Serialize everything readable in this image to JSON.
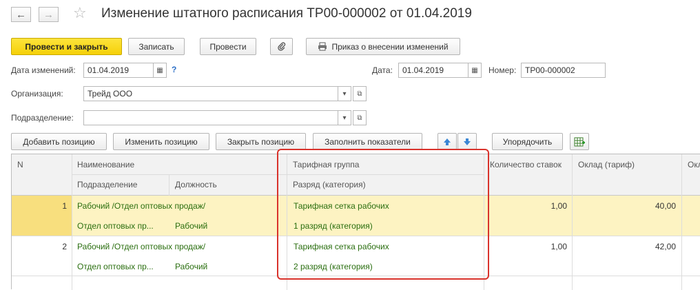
{
  "window": {
    "title": "Изменение штатного расписания ТР00-000002 от 01.04.2019"
  },
  "toolbar": {
    "post_close": "Провести и закрыть",
    "save": "Записать",
    "post": "Провести",
    "order": "Приказ о внесении изменений"
  },
  "form": {
    "date_change_label": "Дата изменений:",
    "date_change_value": "01.04.2019",
    "help_mark": "?",
    "date_label": "Дата:",
    "date_value": "01.04.2019",
    "number_label": "Номер:",
    "number_value": "ТР00-000002",
    "org_label": "Организация:",
    "org_value": "Трейд ООО",
    "dept_label": "Подразделение:",
    "dept_value": ""
  },
  "table_toolbar": {
    "add": "Добавить позицию",
    "change": "Изменить позицию",
    "close": "Закрыть позицию",
    "fill": "Заполнить показатели",
    "sort": "Упорядочить"
  },
  "table": {
    "headers": {
      "n": "N",
      "name": "Наименование",
      "dept": "Подразделение",
      "position": "Должность",
      "tariff_group": "Тарифная группа",
      "rank": "Разряд (категория)",
      "rate_count": "Количество ставок",
      "salary": "Оклад (тариф)",
      "extra": "Окл"
    },
    "rows": [
      {
        "n": "1",
        "name": "Рабочий /Отдел оптовых продаж/",
        "dept": "Отдел оптовых пр...",
        "position": "Рабочий",
        "tariff_group": "Тарифная сетка рабочих",
        "rank": "1 разряд (категория)",
        "rate_count": "1,00",
        "salary": "40,00"
      },
      {
        "n": "2",
        "name": "Рабочий /Отдел оптовых продаж/",
        "dept": "Отдел оптовых пр...",
        "position": "Рабочий",
        "tariff_group": "Тарифная сетка рабочих",
        "rank": "2 разряд (категория)",
        "rate_count": "1,00",
        "salary": "42,00"
      }
    ]
  },
  "colors": {
    "accent_yellow": "#f5d009",
    "selected_row": "#fdf3c2",
    "selected_n_cell": "#f8df7e",
    "green_text": "#2a6e0f",
    "highlight_frame": "#d9322b"
  }
}
